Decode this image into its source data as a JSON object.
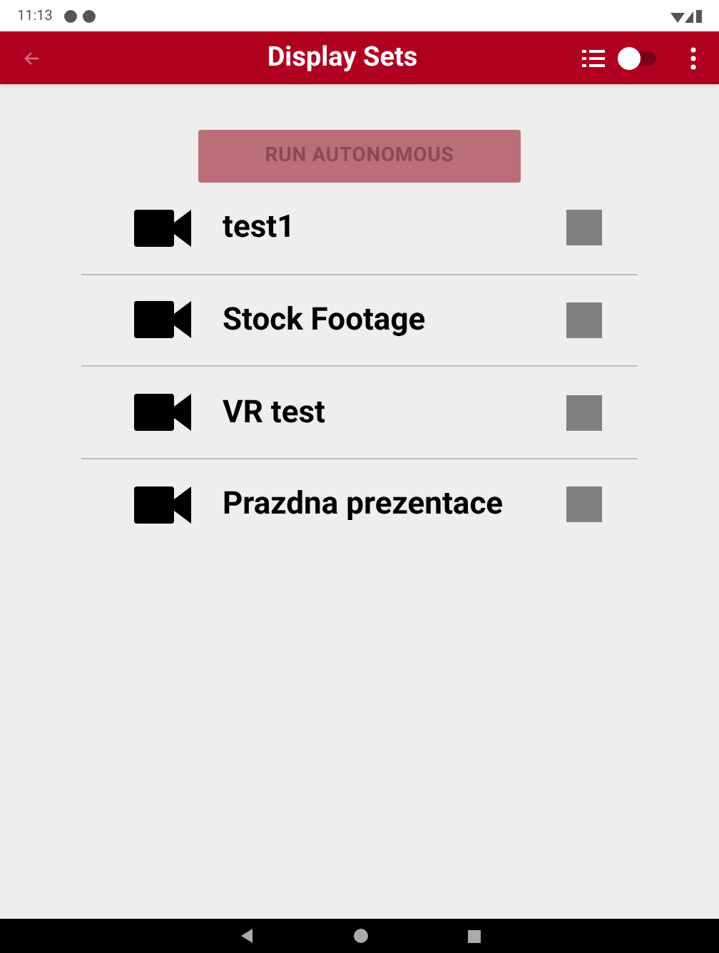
{
  "status_bar": {
    "time": "11:13"
  },
  "app_bar": {
    "title": "Display Sets",
    "toggle": {
      "on": false
    }
  },
  "run_button": {
    "label": "RUN AUTONOMOUS",
    "disabled": true
  },
  "sets": [
    {
      "name": "test1",
      "checked": false,
      "disabled": true
    },
    {
      "name": "Stock Footage",
      "checked": false,
      "disabled": true
    },
    {
      "name": "VR test",
      "checked": false,
      "disabled": true
    },
    {
      "name": "Prazdna prezentace",
      "checked": false,
      "disabled": true
    }
  ]
}
